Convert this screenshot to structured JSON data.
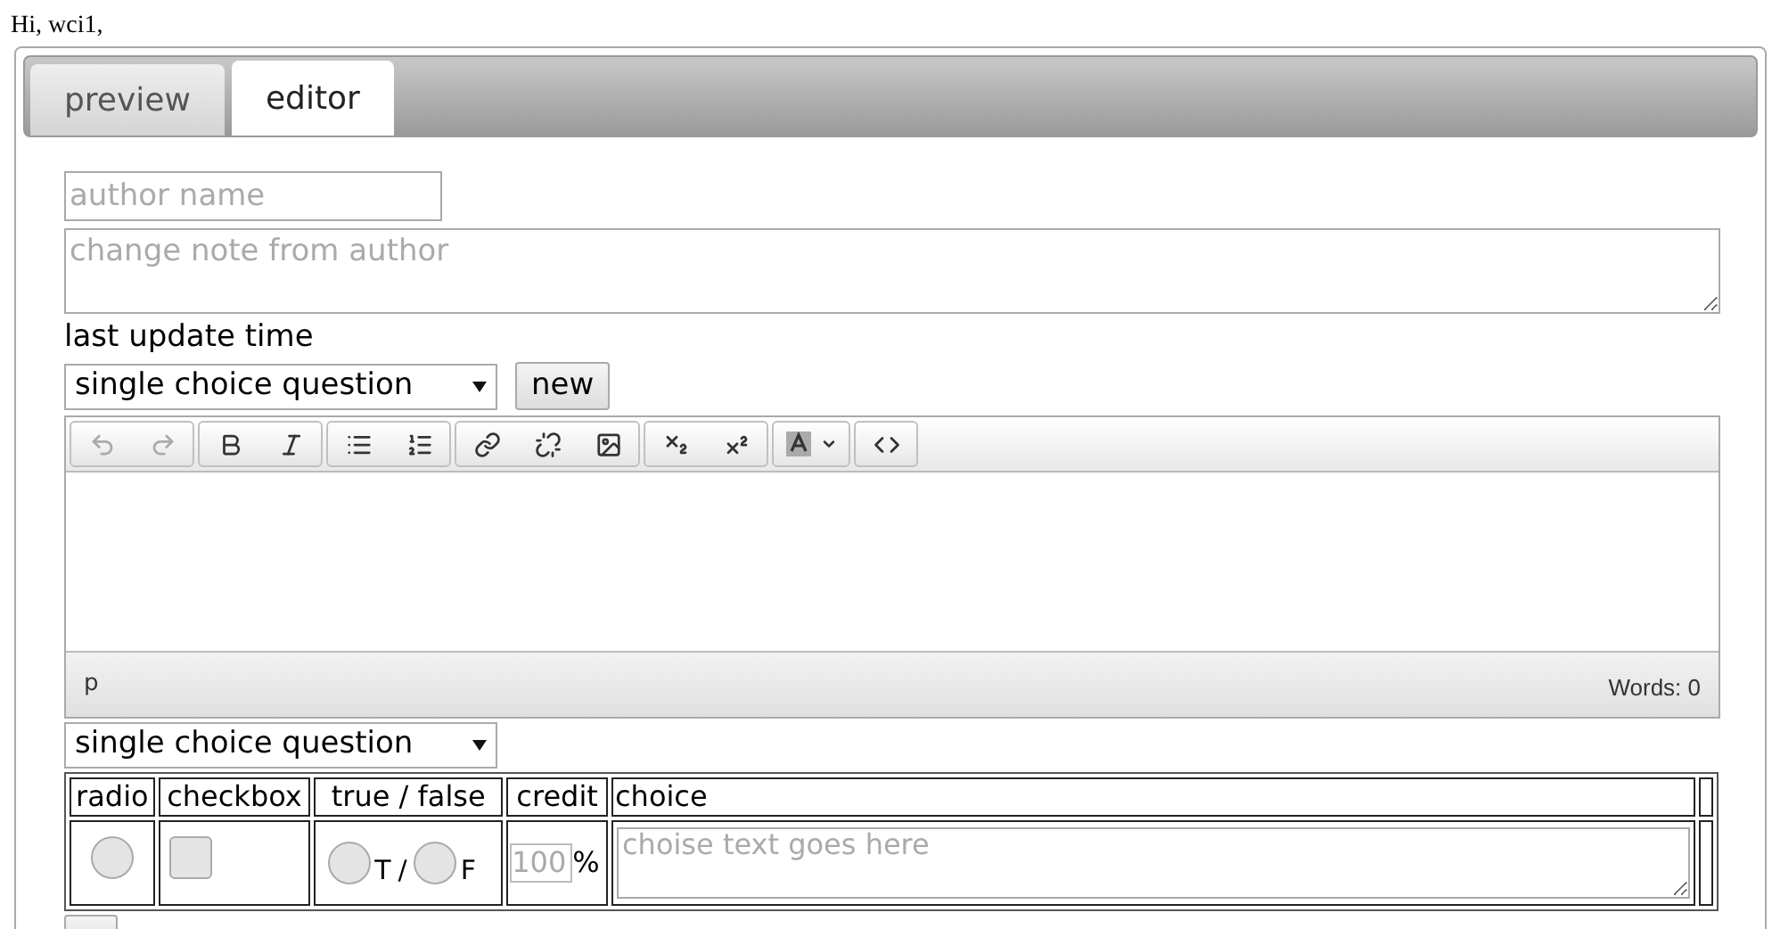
{
  "greeting": "Hi, wci1,",
  "tabs": [
    {
      "label": "preview",
      "selected": false
    },
    {
      "label": "editor",
      "selected": true
    }
  ],
  "author_field": {
    "placeholder": "author name"
  },
  "note_field": {
    "placeholder": "change note from author"
  },
  "update_label": "last update time",
  "type_select": {
    "value": "single choice question"
  },
  "new_button": "new",
  "toolbar": [
    [
      {
        "kind": "undo",
        "disabled": true
      },
      {
        "kind": "redo",
        "disabled": true
      }
    ],
    [
      {
        "kind": "bold",
        "disabled": false
      },
      {
        "kind": "italic",
        "disabled": false
      }
    ],
    [
      {
        "kind": "bullets",
        "disabled": false
      },
      {
        "kind": "numbers",
        "disabled": false
      }
    ],
    [
      {
        "kind": "link",
        "disabled": false
      },
      {
        "kind": "unlink",
        "disabled": false
      },
      {
        "kind": "image",
        "disabled": false
      }
    ],
    [
      {
        "kind": "subscript",
        "disabled": false
      },
      {
        "kind": "superscript",
        "disabled": false
      }
    ],
    [
      {
        "kind": "textcolor",
        "disabled": false
      }
    ],
    [
      {
        "kind": "code",
        "disabled": false
      }
    ]
  ],
  "status_bar": {
    "path": "p",
    "words": "Words: 0"
  },
  "question_select": {
    "value": "single choice question"
  },
  "table": {
    "columns": [
      "radio",
      "checkbox",
      "true / false",
      "credit",
      "choice"
    ],
    "rows": [
      {
        "radio_checked": false,
        "checkbox_checked": false,
        "true_label": "T",
        "separator": "/",
        "false_label": "F",
        "true_checked": false,
        "false_checked": false,
        "credit_placeholder": "100",
        "percent": "%",
        "choice_placeholder": "choise text goes here"
      }
    ]
  }
}
